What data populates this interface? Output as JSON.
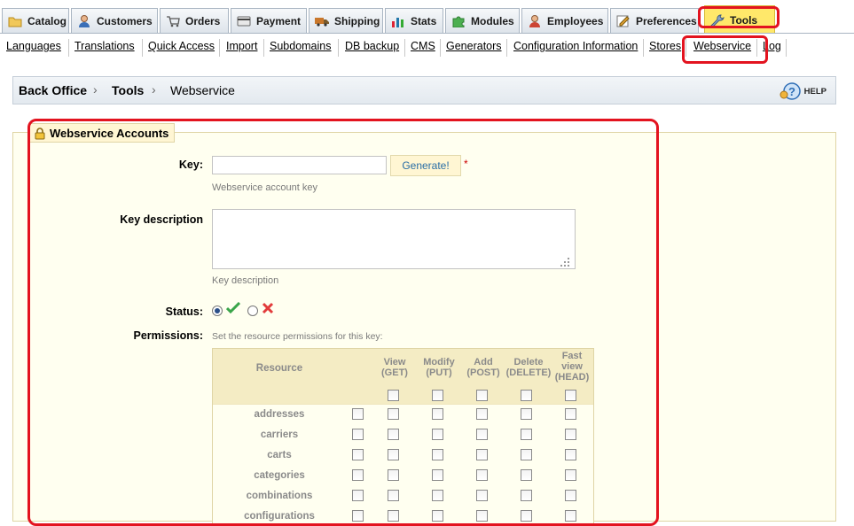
{
  "tabs": [
    {
      "label": "Catalog",
      "icon": "folder-icon"
    },
    {
      "label": "Customers",
      "icon": "user-icon"
    },
    {
      "label": "Orders",
      "icon": "cart-icon"
    },
    {
      "label": "Payment",
      "icon": "credit-card-icon"
    },
    {
      "label": "Shipping",
      "icon": "truck-icon"
    },
    {
      "label": "Stats",
      "icon": "chart-icon"
    },
    {
      "label": "Modules",
      "icon": "puzzle-icon"
    },
    {
      "label": "Employees",
      "icon": "employee-icon"
    },
    {
      "label": "Preferences",
      "icon": "preferences-icon"
    },
    {
      "label": "Tools",
      "icon": "wrench-icon",
      "active": true
    }
  ],
  "subnav": [
    "Languages",
    "Translations",
    "Quick Access",
    "Import",
    "Subdomains",
    "DB backup",
    "CMS",
    "Generators",
    "Configuration Information",
    "Stores",
    "Webservice",
    "Log"
  ],
  "breadcrumb": [
    "Back Office",
    "Tools",
    "Webservice"
  ],
  "help_label": "HELP",
  "form": {
    "legend": "Webservice Accounts",
    "key_label": "Key:",
    "key_value": "",
    "generate_label": "Generate!",
    "required_mark": "*",
    "key_hint": "Webservice account key",
    "desc_label": "Key description",
    "desc_hint": "Key description",
    "status_label": "Status:",
    "status_enabled": true,
    "permissions_label": "Permissions:",
    "permissions_hint": "Set the resource permissions for this key:"
  },
  "table": {
    "resource_header": "Resource",
    "columns": [
      [
        "View",
        "(GET)"
      ],
      [
        "Modify",
        "(PUT)"
      ],
      [
        "Add",
        "(POST)"
      ],
      [
        "Delete",
        "(DELETE)"
      ],
      [
        "Fast",
        "view",
        "(HEAD)"
      ]
    ],
    "rows": [
      "addresses",
      "carriers",
      "carts",
      "categories",
      "combinations",
      "configurations"
    ]
  },
  "colors": {
    "annotation_red": "#e3131f",
    "active_tab": "#ffe86a",
    "fieldset_bg": "#fffff0"
  }
}
